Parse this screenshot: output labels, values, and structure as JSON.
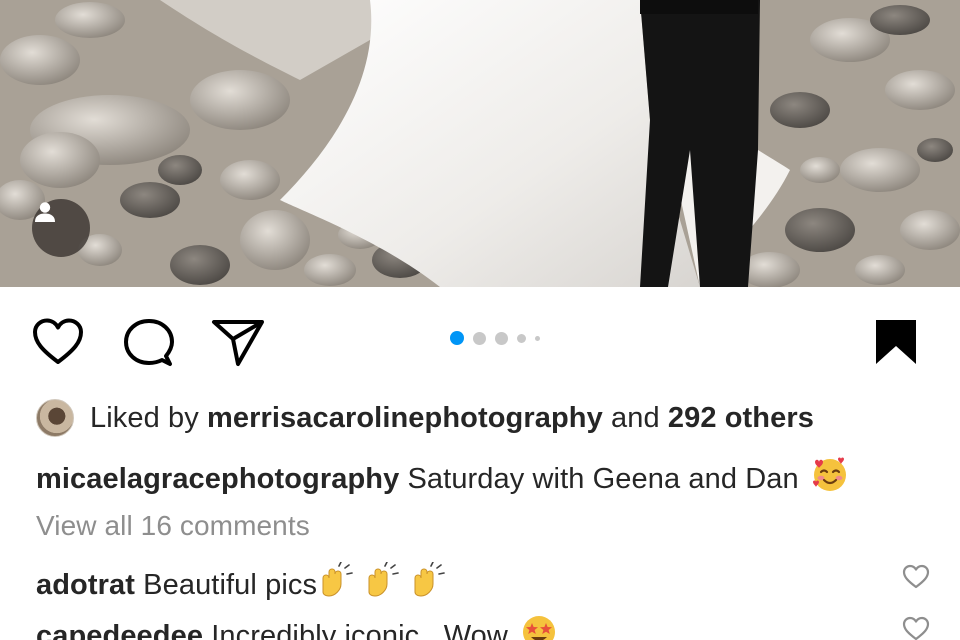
{
  "post": {
    "photo_alt": "",
    "carousel": {
      "total": 5,
      "current": 1
    }
  },
  "actions": {
    "like_icon": "heart-icon",
    "comment_icon": "comment-icon",
    "share_icon": "paper-plane-icon",
    "save_icon": "bookmark-icon"
  },
  "likes": {
    "prefix": "Liked by",
    "user": "merrisacarolinephotography",
    "joiner": "and",
    "others": "292 others"
  },
  "caption": {
    "author": "micaelagracephotography",
    "text": "Saturday with Geena and Dan",
    "emoji": "smiling-face-with-hearts"
  },
  "view_all": "View all 16 comments",
  "comments": [
    {
      "user": "adotrat",
      "text": "Beautiful pics",
      "emoji": "clapping-hands x3"
    },
    {
      "user": "capedeedee",
      "text": "Incredibly iconic . Wow",
      "emoji": "star-struck"
    }
  ],
  "colors": {
    "accent": "#0095f6",
    "text": "#262626",
    "muted": "#8e8e8e",
    "dot_inactive": "#c8c8c8"
  }
}
